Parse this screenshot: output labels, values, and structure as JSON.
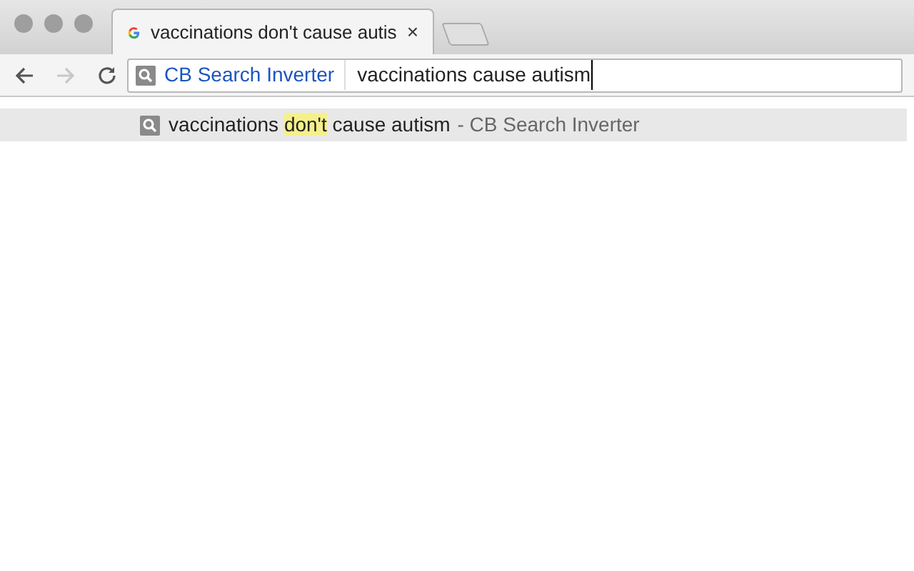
{
  "tab": {
    "title": "vaccinations don't cause autis",
    "close": "×"
  },
  "omnibox": {
    "keyword": "CB Search Inverter",
    "value": "vaccinations cause autism"
  },
  "suggestions": [
    {
      "parts": [
        {
          "text": "vaccinations ",
          "highlighted": false
        },
        {
          "text": "don't",
          "highlighted": true
        },
        {
          "text": " cause autism",
          "highlighted": false
        }
      ],
      "source": "- CB Search Inverter",
      "selected": true
    }
  ]
}
